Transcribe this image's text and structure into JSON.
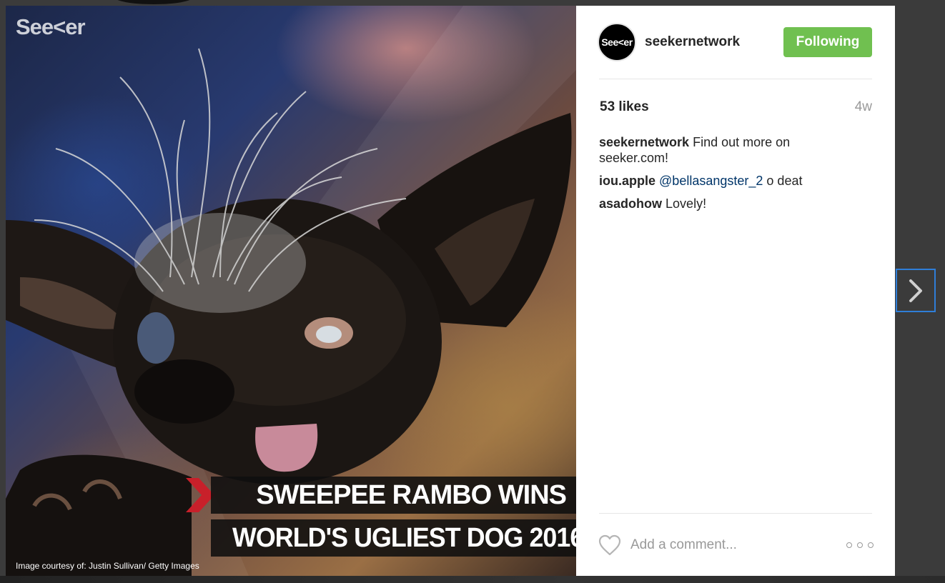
{
  "image": {
    "brand_logo": "See<er",
    "headline_line1": "SWEEPEE RAMBO WINS",
    "headline_line2": "WORLD'S UGLIEST DOG 2016",
    "credit": "Image courtesy of: Justin Sullivan/ Getty Images"
  },
  "post": {
    "avatar_text": "See<er",
    "username": "seekernetwork",
    "follow_label": "Following",
    "likes": "53 likes",
    "age": "4w"
  },
  "comments": [
    {
      "author": "seekernetwork",
      "text": "Find out more on seeker.com!"
    },
    {
      "author": "iou.apple",
      "mention": "@bellasangster_2",
      "text": "o deat"
    },
    {
      "author": "asadohow",
      "text": "Lovely!"
    }
  ],
  "comment_box": {
    "placeholder": "Add a comment..."
  },
  "icons": {
    "like": "heart-icon",
    "options": "more-options-icon",
    "next": "chevron-right-icon"
  },
  "colors": {
    "follow_green": "#70c050",
    "mention_blue": "#003569",
    "next_focus": "#2f7ed8",
    "headline_arrow": "#c8202a"
  }
}
